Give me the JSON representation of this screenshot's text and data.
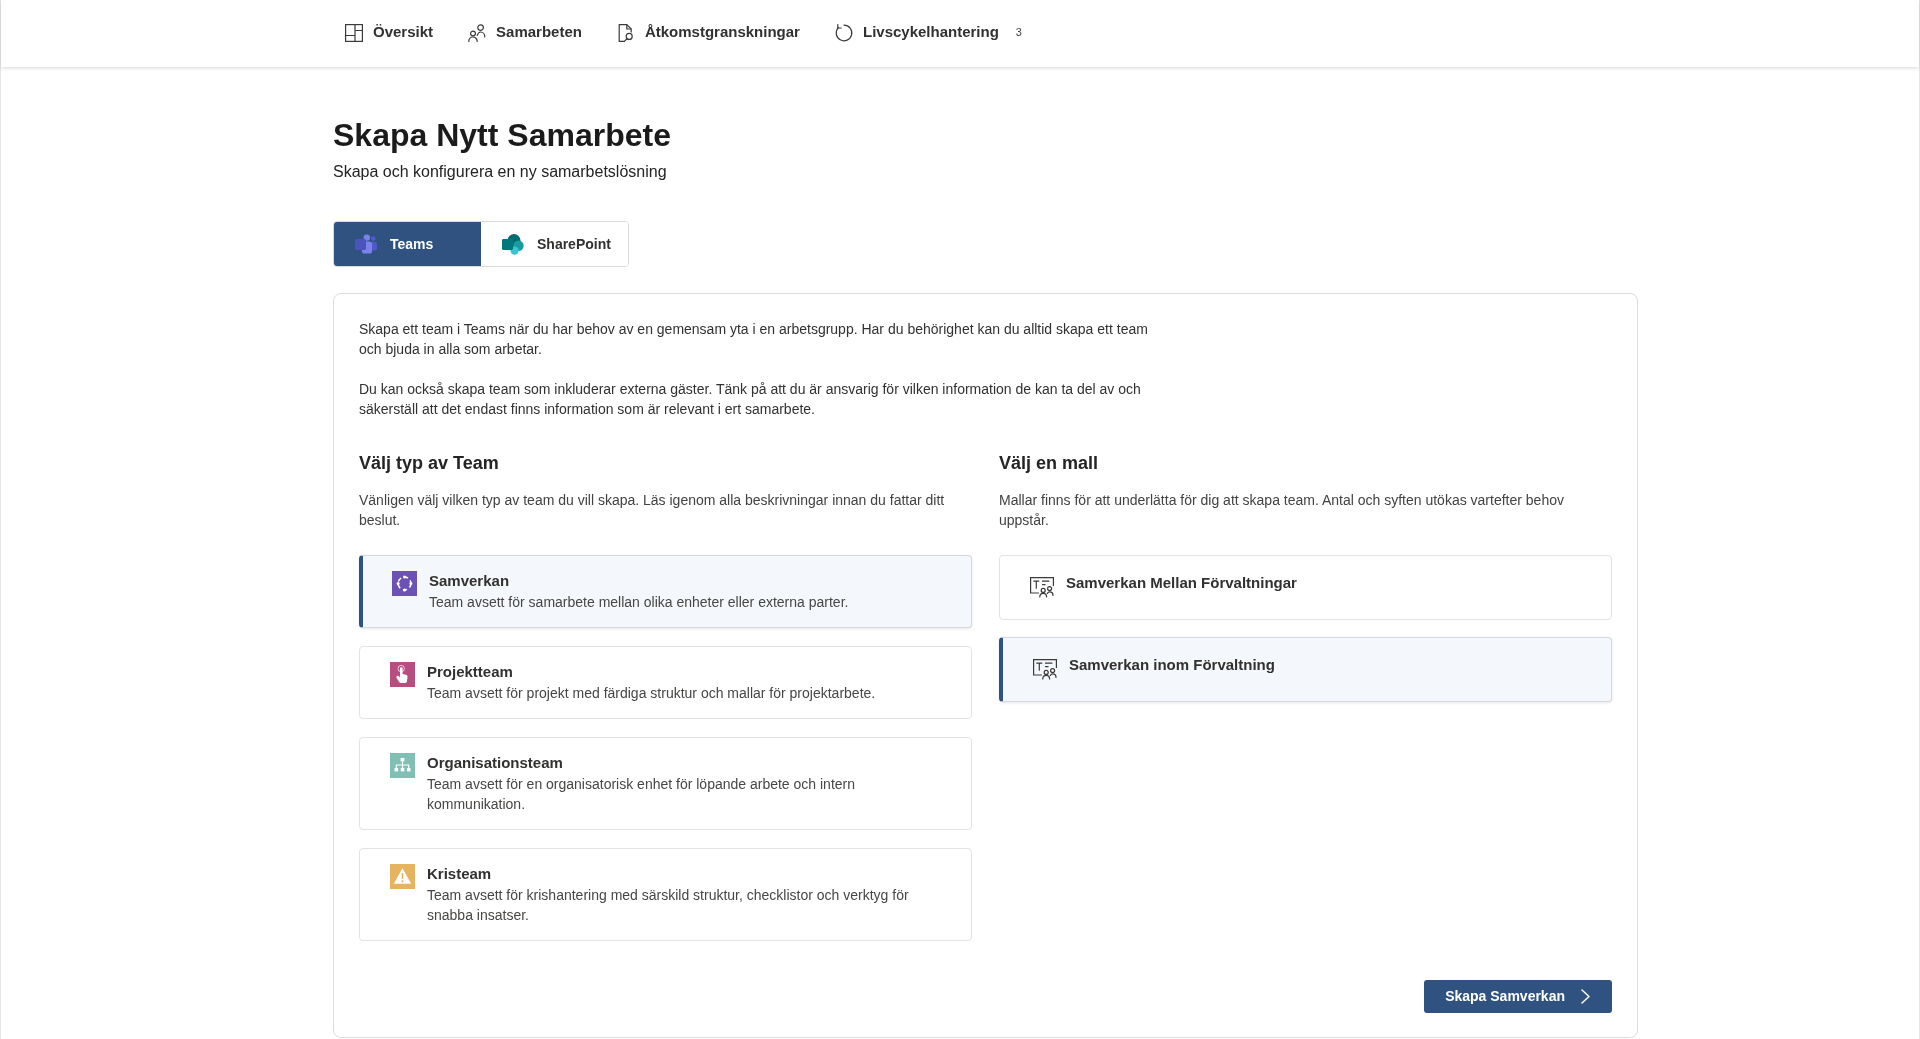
{
  "nav": [
    {
      "label": "Översikt",
      "selected": false
    },
    {
      "label": "Samarbeten",
      "selected": false
    },
    {
      "label": "Åtkomstgranskningar",
      "selected": false
    },
    {
      "label": "Livscykelhantering",
      "selected": false,
      "count": "3"
    }
  ],
  "page": {
    "title": "Skapa Nytt Samarbete",
    "subtitle": "Skapa och konfigurera en ny samarbetslösning"
  },
  "tabs": [
    {
      "label": "Teams",
      "selected": true
    },
    {
      "label": "SharePoint",
      "selected": false
    }
  ],
  "card": {
    "paragraphs": [
      "Skapa ett team i Teams när du har behov av en gemensam yta i en arbetsgrupp. Har du behörighet kan du alltid skapa ett team och bjuda in alla som arbetar.",
      "Du kan också skapa team som inkluderar externa gäster. Tänk på att du är ansvarig för vilken information de kan ta del av och säkerställ att det endast finns information som är relevant i ert samarbete."
    ],
    "team_types": {
      "heading": "Välj typ av Team",
      "description": "Vänligen välj vilken typ av team du vill skapa. Läs igenom alla beskrivningar innan du fattar ditt beslut.",
      "options": [
        {
          "title": "Samverkan",
          "description": "Team avsett för samarbete mellan olika enheter eller externa parter.",
          "selected": true
        },
        {
          "title": "Projektteam",
          "description": "Team avsett för projekt med färdiga struktur och mallar för projektarbete.",
          "selected": false
        },
        {
          "title": "Organisationsteam",
          "description": "Team avsett för en organisatorisk enhet för löpande arbete och intern kommunikation.",
          "selected": false
        },
        {
          "title": "Kristeam",
          "description": "Team avsett för krishantering med särskild struktur, checklistor och verktyg för snabba insatser.",
          "selected": false
        }
      ]
    },
    "templates": {
      "heading": "Välj en mall",
      "description": "Mallar finns för att underlätta för dig att skapa team. Antal och syften utökas vartefter behov uppstår.",
      "options": [
        {
          "title": "Samverkan Mellan Förvaltningar",
          "selected": false
        },
        {
          "title": "Samverkan inom Förvaltning",
          "selected": true
        }
      ]
    },
    "button": {
      "label": "Skapa Samverkan"
    }
  }
}
